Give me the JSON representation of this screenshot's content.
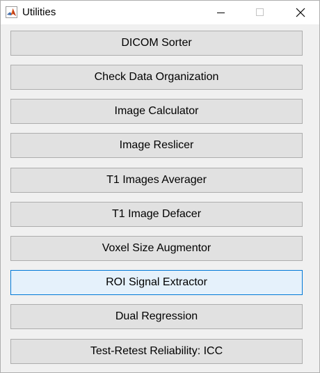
{
  "window": {
    "title": "Utilities",
    "icon": "matlab-icon"
  },
  "controls": {
    "minimize_icon": "minimize-icon",
    "maximize_icon": "maximize-icon",
    "close_icon": "close-icon"
  },
  "buttons": [
    {
      "label": "DICOM Sorter"
    },
    {
      "label": "Check Data Organization"
    },
    {
      "label": "Image Calculator"
    },
    {
      "label": "Image Reslicer"
    },
    {
      "label": "T1 Images Averager"
    },
    {
      "label": "T1 Image Defacer"
    },
    {
      "label": "Voxel Size Augmentor"
    },
    {
      "label": "ROI Signal Extractor",
      "state": "hover"
    },
    {
      "label": "Dual Regression"
    },
    {
      "label": "Test-Retest Reliability: ICC"
    }
  ],
  "colors": {
    "button_face": "#e1e1e1",
    "button_hover_face": "#e5f1fb",
    "button_hover_border": "#0078d7",
    "background": "#f0f0f0"
  }
}
